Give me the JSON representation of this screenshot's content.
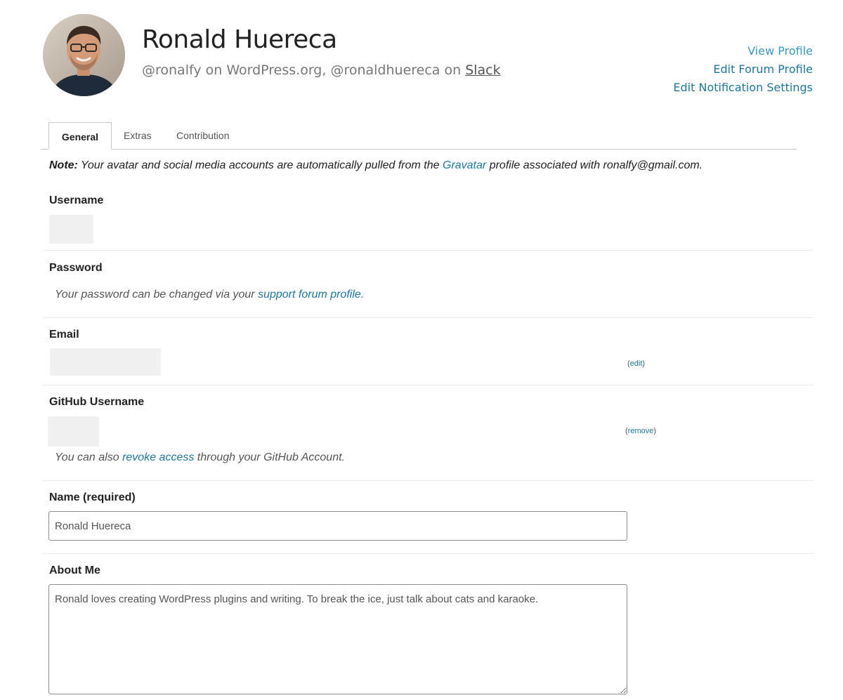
{
  "profile": {
    "name": "Ronald Huereca",
    "handle_wporg": "@ronalfy on WordPress.org, @ronaldhuereca on ",
    "slack_label": "Slack"
  },
  "header_links": {
    "view_profile": "View Profile",
    "edit_forum_profile": "Edit Forum Profile",
    "edit_notification_settings": "Edit Notification Settings"
  },
  "tabs": [
    {
      "label": "General",
      "active": true
    },
    {
      "label": "Extras",
      "active": false
    },
    {
      "label": "Contribution",
      "active": false
    }
  ],
  "note": {
    "prefix": "Note:",
    "text_before": " Your avatar and social media accounts are automatically pulled from the ",
    "link": "Gravatar",
    "text_after": " profile associated with ronalfy@gmail.com."
  },
  "fields": {
    "username_label": "Username",
    "password_label": "Password",
    "password_hint_before": "Your password can be changed via your ",
    "password_hint_link": "support forum profile",
    "password_hint_after": ".",
    "email_label": "Email",
    "email_edit_link": "edit",
    "github_label": "GitHub Username",
    "github_remove_link": "remove",
    "github_hint_before": "You can also ",
    "github_hint_link": "revoke access",
    "github_hint_after": " through your GitHub Account.",
    "name_label": "Name (required)",
    "name_value": "Ronald Huereca",
    "about_label": "About Me",
    "about_value": "Ronald loves creating WordPress plugins and writing. To break the ice, just talk about cats and karaoke."
  },
  "colors": {
    "link": "#21759b",
    "divider": "#ececec",
    "field_gray": "#f0f0f0"
  }
}
